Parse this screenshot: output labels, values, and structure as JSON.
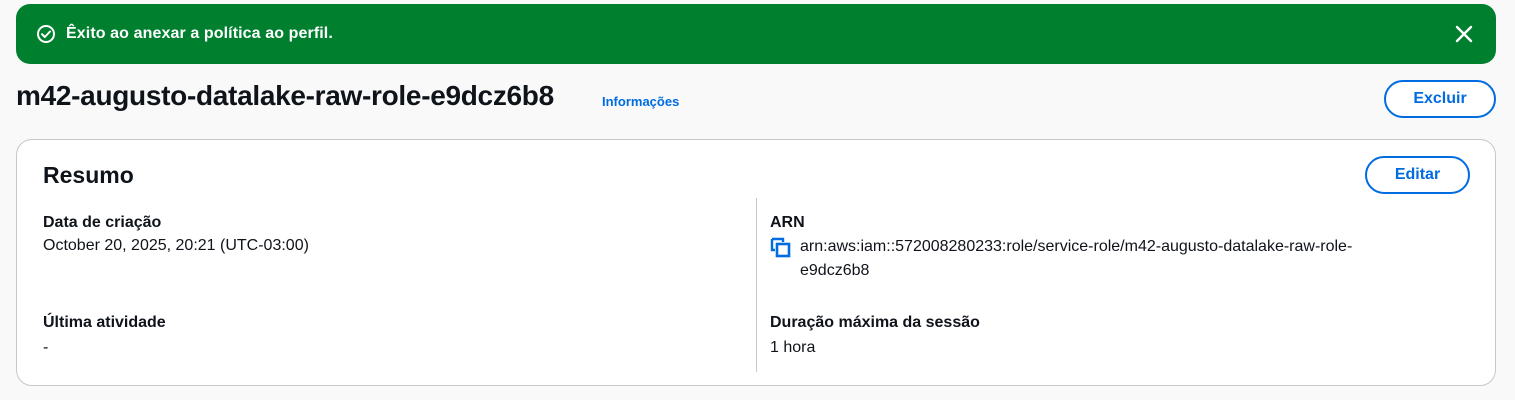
{
  "flash": {
    "message": "Êxito ao anexar a política ao perfil.",
    "icon": "check-circle-icon",
    "close_icon": "close-icon",
    "color": "#00802f"
  },
  "header": {
    "title": "m42-augusto-datalake-raw-role-e9dcz6b8",
    "info_link": "Informações",
    "delete_label": "Excluir"
  },
  "summary": {
    "title": "Resumo",
    "edit_label": "Editar",
    "created_label": "Data de criação",
    "created_value": "October 20, 2025, 20:21 (UTC-03:00)",
    "last_activity_label": "Última atividade",
    "last_activity_value": "-",
    "arn_label": "ARN",
    "arn_line1": "arn:aws:iam::572008280233:role/service-role/m42-augusto-datalake-raw-role-",
    "arn_line2": "e9dcz6b8",
    "max_session_label": "Duração máxima da sessão",
    "max_session_value": "1 hora"
  },
  "colors": {
    "accent": "#006ce0",
    "success": "#00802f",
    "text": "#0f141a",
    "border": "#c6c6cd"
  }
}
